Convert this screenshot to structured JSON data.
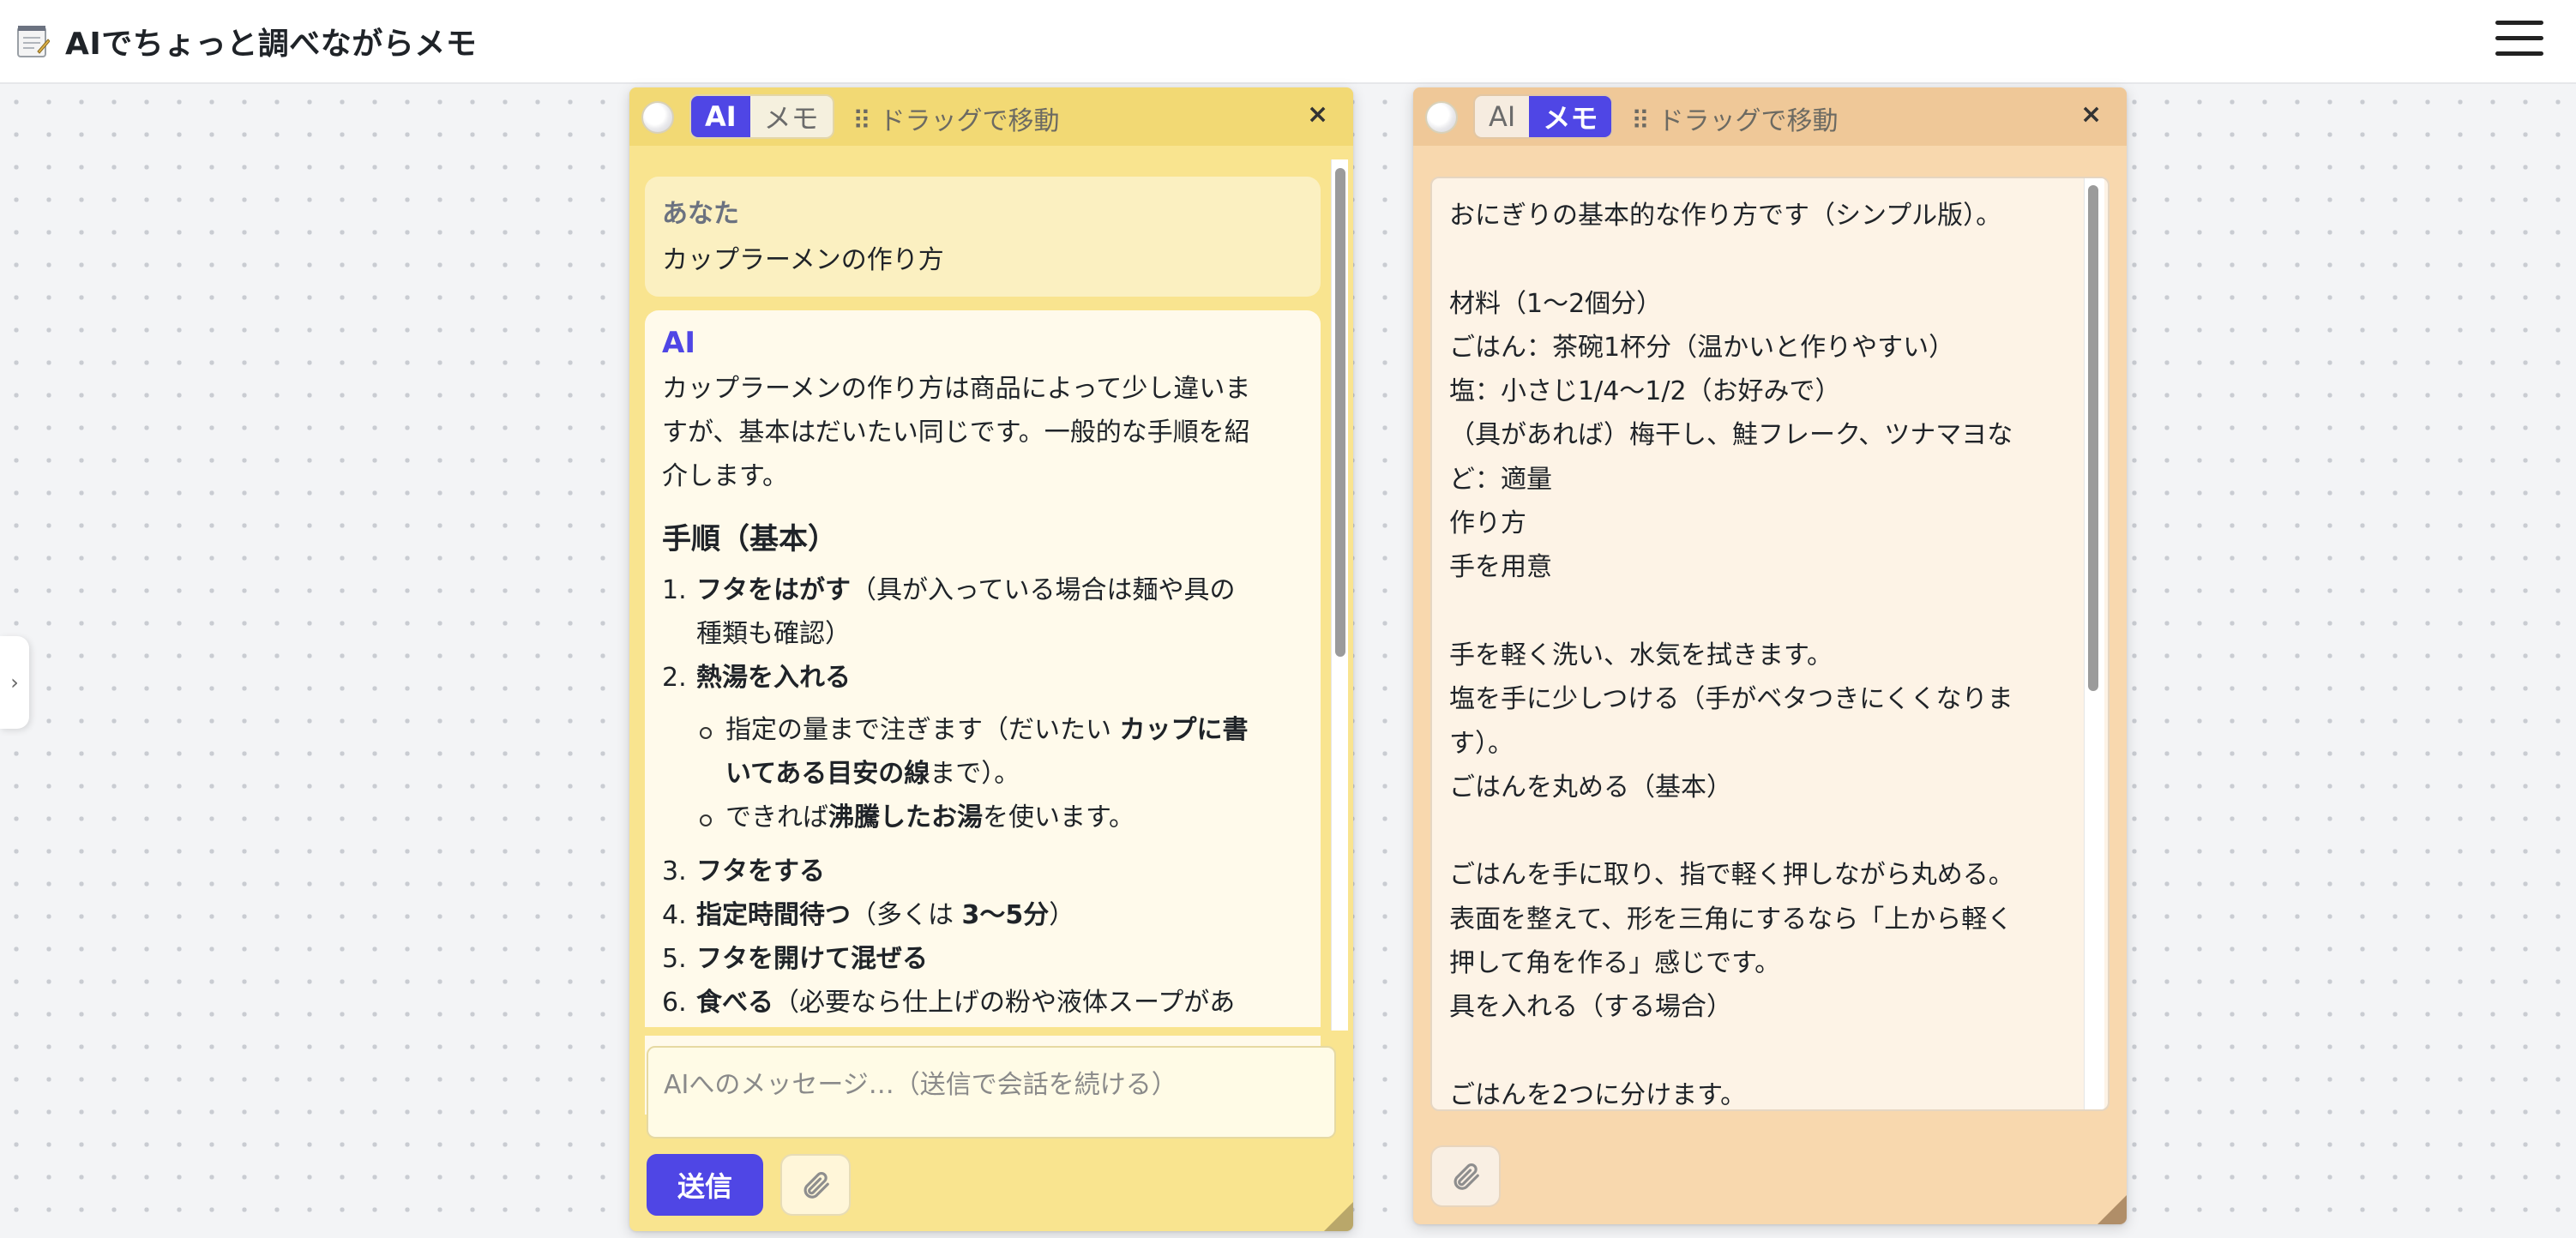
{
  "app": {
    "title": "AIでちょっと調べながらメモ",
    "icon": "notepad-icon"
  },
  "side_handle": {
    "glyph": "›"
  },
  "ai_panel": {
    "color": "#f9e48f",
    "tabs": {
      "ai": "AI",
      "memo": "メモ",
      "active": "ai"
    },
    "drag_label": "⠿ ドラッグで移動",
    "close_label": "×",
    "user_message": {
      "sender": "あなた",
      "text": "カップラーメンの作り方"
    },
    "ai_message": {
      "sender": "AI",
      "intro_lines": [
        "カップラーメンの作り方は商品によって少し違いま",
        "すが、基本はだいたい同じです。一般的な手順を紹",
        "介します。"
      ],
      "heading": "手順（基本）",
      "step1": {
        "num": "1.",
        "bold": "フタをはがす",
        "rest_a": "（具が入っている場合は麺や具の",
        "rest_b": "種類も確認）"
      },
      "step2": {
        "num": "2.",
        "bold": "熱湯を入れる"
      },
      "sub1": {
        "a": "指定の量まで注ぎます（だいたい ",
        "bold_a": "カップに書",
        "bold_b": "いてある目安の線",
        "b": "まで）。"
      },
      "sub2": {
        "a": "できれば",
        "bold": "沸騰したお湯",
        "b": "を使います。"
      },
      "step3": {
        "num": "3.",
        "bold": "フタをする"
      },
      "step4": {
        "num": "4.",
        "bold": "指定時間待つ",
        "rest": "（多くは ",
        "bold2": "3〜5分",
        "rest2": "）"
      },
      "step5": {
        "num": "5.",
        "bold": "フタを開けて混ぜる"
      },
      "step6": {
        "num": "6.",
        "bold": "食べる",
        "rest": "（必要なら仕上げの粉や液体スープがあ"
      }
    },
    "composer_placeholder": "AIへのメッセージ…（送信で会話を続ける）",
    "send_label": "送信"
  },
  "memo_panel": {
    "color": "#f8d8ae",
    "tabs": {
      "ai": "AI",
      "memo": "メモ",
      "active": "memo"
    },
    "drag_label": "⠿ ドラッグで移動",
    "close_label": "×",
    "lines": [
      "おにぎりの基本的な作り方です（シンプル版）。",
      "",
      "材料（1〜2個分）",
      "ごはん：茶碗1杯分（温かいと作りやすい）",
      "塩：小さじ1/4〜1/2（お好みで）",
      "（具があれば）梅干し、鮭フレーク、ツナマヨな",
      "ど：適量",
      "作り方",
      "手を用意",
      "",
      "手を軽く洗い、水気を拭きます。",
      "塩を手に少しつける（手がベタつきにくくなりま",
      "す）。",
      "ごはんを丸める（基本）",
      "",
      "ごはんを手に取り、指で軽く押しながら丸める。",
      "表面を整えて、形を三角にするなら「上から軽く",
      "押して角を作る」感じです。",
      "具を入れる（する場合）",
      "",
      "ごはんを2つに分けます。"
    ]
  }
}
